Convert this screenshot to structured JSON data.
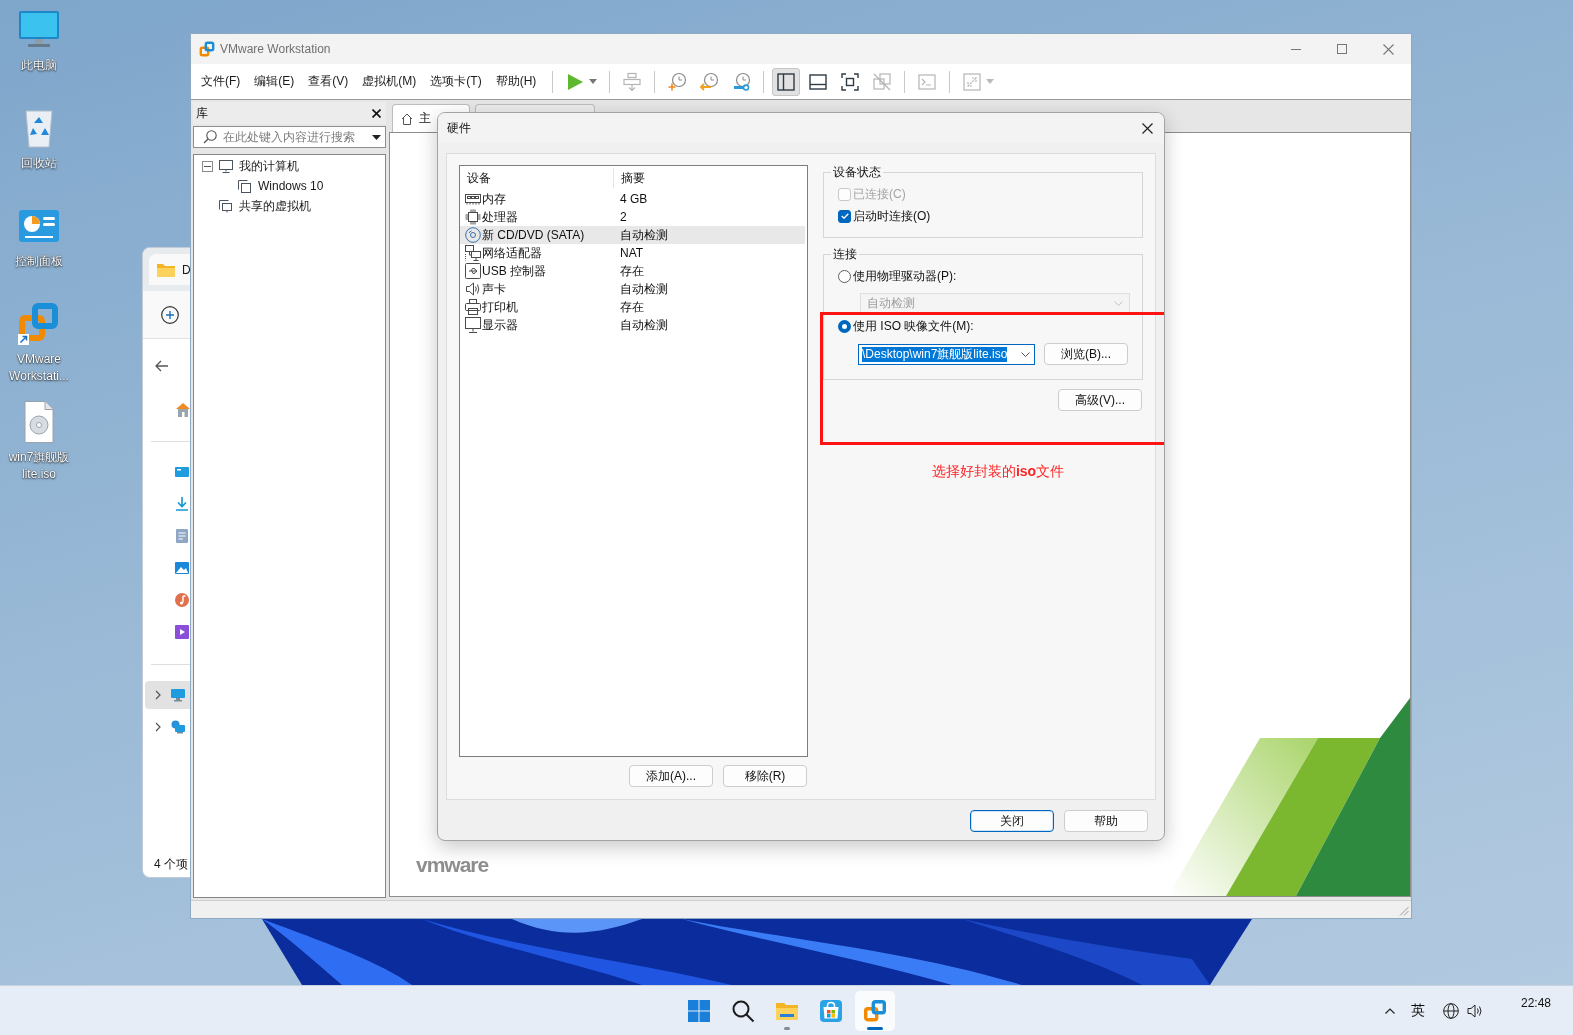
{
  "desktop_icons": [
    {
      "label": "此电脑",
      "kind": "pc"
    },
    {
      "label": "回收站",
      "kind": "recycle-bin"
    },
    {
      "label": "控制面板",
      "kind": "control-panel"
    },
    {
      "label": "VMware Workstati...",
      "kind": "vmware"
    },
    {
      "label": "win7旗舰版lite.iso",
      "kind": "disc-file"
    }
  ],
  "explorer": {
    "tab_title": "D",
    "nav": [
      {
        "kind": "pc",
        "selected": true
      },
      {
        "kind": "network",
        "selected": false
      }
    ],
    "status": "4 个项"
  },
  "window": {
    "title": "VMware Workstation",
    "menu": [
      "文件(F)",
      "编辑(E)",
      "查看(V)",
      "虚拟机(M)",
      "选项卡(T)",
      "帮助(H)"
    ],
    "toolbar": [
      [
        {
          "kind": "play",
          "dropdown": true,
          "selected": false,
          "disabled": false
        }
      ],
      [
        {
          "kind": "send-keys",
          "dropdown": false,
          "selected": false,
          "disabled": true
        }
      ],
      [
        {
          "kind": "snapshot-take",
          "dropdown": false,
          "selected": false,
          "disabled": false
        },
        {
          "kind": "snapshot-revert",
          "dropdown": false,
          "selected": false,
          "disabled": false
        },
        {
          "kind": "snapshot-manager",
          "dropdown": false,
          "selected": false,
          "disabled": false
        }
      ],
      [
        {
          "kind": "view-library",
          "dropdown": false,
          "selected": true,
          "disabled": false
        },
        {
          "kind": "view-thumbnail",
          "dropdown": false,
          "selected": false,
          "disabled": false
        },
        {
          "kind": "view-fullscreen",
          "dropdown": false,
          "selected": false,
          "disabled": false
        },
        {
          "kind": "view-unity",
          "dropdown": false,
          "selected": false,
          "disabled": true
        }
      ],
      [
        {
          "kind": "console",
          "dropdown": false,
          "selected": false,
          "disabled": true
        }
      ],
      [
        {
          "kind": "stretch",
          "dropdown": true,
          "selected": false,
          "disabled": true
        }
      ]
    ]
  },
  "library": {
    "title": "库",
    "search_placeholder": "在此处键入内容进行搜索",
    "tree": [
      {
        "label": "我的计算机",
        "kind": "computer",
        "expanded": true,
        "children": [
          {
            "label": "Windows 10",
            "kind": "vm"
          }
        ]
      },
      {
        "label": "共享的虚拟机",
        "kind": "shared"
      }
    ]
  },
  "tabs": [
    {
      "label": "主",
      "kind": "home",
      "selected": true
    },
    {
      "kind": "vm",
      "selected": false
    }
  ],
  "logo": "vmware",
  "dialog": {
    "title": "硬件",
    "columns": [
      "设备",
      "摘要"
    ],
    "devices": [
      {
        "name": "内存",
        "summary": "4 GB",
        "kind": "memory",
        "selected": false
      },
      {
        "name": "处理器",
        "summary": "2",
        "kind": "cpu",
        "selected": false
      },
      {
        "name": "新 CD/DVD (SATA)",
        "summary": "自动检测",
        "kind": "cdrom",
        "selected": true
      },
      {
        "name": "网络适配器",
        "summary": "NAT",
        "kind": "network",
        "selected": false
      },
      {
        "name": "USB 控制器",
        "summary": "存在",
        "kind": "usb",
        "selected": false
      },
      {
        "name": "声卡",
        "summary": "自动检测",
        "kind": "sound",
        "selected": false
      },
      {
        "name": "打印机",
        "summary": "存在",
        "kind": "printer",
        "selected": false
      },
      {
        "name": "显示器",
        "summary": "自动检测",
        "kind": "display",
        "selected": false
      }
    ],
    "list_buttons": [
      "添加(A)...",
      "移除(R)"
    ],
    "device_status": {
      "title": "设备状态",
      "options": [
        {
          "label": "已连接(C)",
          "checked": false,
          "disabled": true
        },
        {
          "label": "启动时连接(O)",
          "checked": true,
          "disabled": false
        }
      ]
    },
    "connection": {
      "title": "连接",
      "options": [
        {
          "label": "使用物理驱动器(P):",
          "selected": false
        },
        {
          "label": "使用 ISO 映像文件(M):",
          "selected": true
        }
      ],
      "drive": {
        "value": "自动检测",
        "disabled": true
      },
      "iso_path": {
        "value": "\\Desktop\\win7旗舰版lite.iso",
        "highlighted": true
      },
      "browse": "浏览(B)..."
    },
    "advanced": "高级(V)...",
    "buttons": [
      {
        "label": "关闭",
        "default": true
      },
      {
        "label": "帮助",
        "default": false
      }
    ]
  },
  "annotation": {
    "note": "选择好封装的**iso**文件"
  },
  "taskbar": {
    "apps": [
      {
        "kind": "start",
        "running": false,
        "selected": false
      },
      {
        "kind": "search",
        "running": false,
        "selected": false
      },
      {
        "kind": "explorer",
        "running": true,
        "selected": false
      },
      {
        "kind": "store",
        "running": false,
        "selected": false
      },
      {
        "kind": "vmware",
        "running": true,
        "selected": true
      }
    ],
    "language": "英",
    "time": "22:48"
  }
}
